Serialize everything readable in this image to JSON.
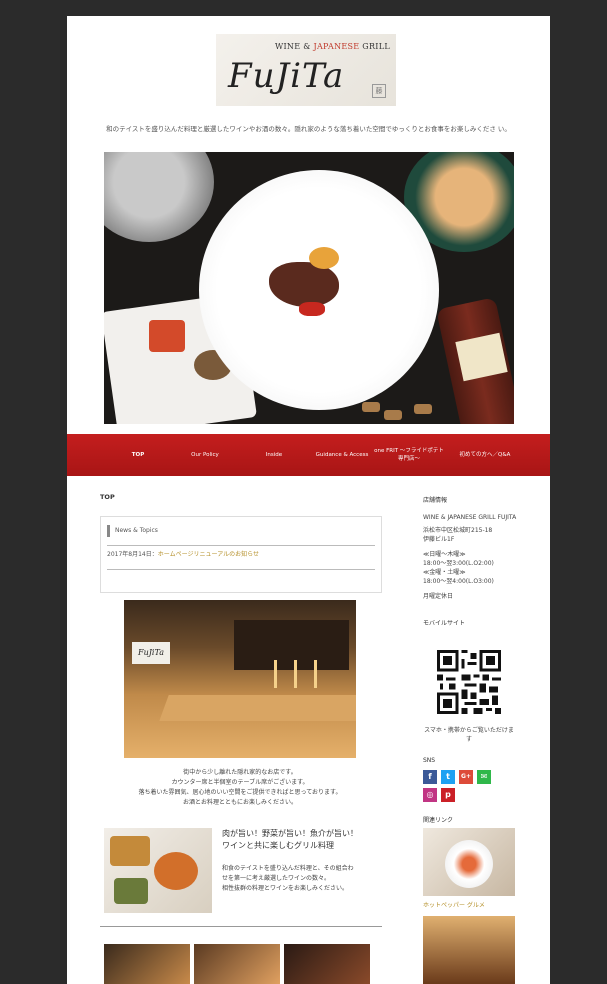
{
  "header": {
    "logo_tag_before": "WINE & ",
    "logo_tag_jp": "JAPANESE",
    "logo_tag_after": " GRILL",
    "logo_name": "FuJiTa",
    "logo_seal": "藤",
    "tagline": "和のテイストを盛り込んだ料理と厳選したワインやお酒の数々。隠れ家のような落ち着いた空間でゆっくりとお食事をお楽しみくださ い。"
  },
  "nav": {
    "items": [
      {
        "label": "TOP"
      },
      {
        "label": "Our Policy"
      },
      {
        "label": "Inside"
      },
      {
        "label": "Guidance & Access"
      },
      {
        "label": "one FRIT ～フライドポテト専門店～"
      },
      {
        "label": "初めての方へ／Q&A"
      }
    ]
  },
  "main": {
    "page_title": "TOP",
    "news": {
      "heading": "News & Topics",
      "date": "2017年8月14日",
      "sep": "：",
      "link": "ホームページリニューアルのお知らせ"
    },
    "intro_lines": [
      "街中から少し離れた隠れ家的なお店です。",
      "カウンター席と半個室のテーブル席がございます。",
      "落ち着いた雰囲気、居心地のいい空間をご提供できればと思っております。",
      "お酒とお料理とともにお楽しみください。"
    ],
    "feature": {
      "title_line1": "肉が旨い！野菜が旨い！魚介が旨い！",
      "title_line2": "ワインと共に楽しむグリル料理",
      "text_lines": [
        "和食のテイストを盛り込んだ料理と、その組合わ",
        "せを第一に考え厳選したワインの数々。",
        "相性抜群の料理とワインをお楽しみください。"
      ]
    },
    "interior_sign": "FuJiTa"
  },
  "sidebar": {
    "shop_info_heading": "店舗情報",
    "shop_name": "WINE & JAPANESE GRILL FUJITA",
    "address_line1": "浜松市中区松城町215-18",
    "address_line2": "伊藤ビル1F",
    "hours_line1": "≪日曜～木曜≫",
    "hours_line2": "18:00～翌3:00(L.O2:00)",
    "hours_line3": "≪金曜・土曜≫",
    "hours_line4": "18:00～翌4:00(L.O3:00)",
    "closed": "月曜定休日",
    "mobile_heading": "モバイルサイト",
    "mobile_caption": "スマホ・携帯からご覧いただけます",
    "sns_heading": "SNS",
    "sns_icons": [
      {
        "name": "facebook-icon",
        "glyph": "f",
        "color": "#3b5998"
      },
      {
        "name": "twitter-icon",
        "glyph": "t",
        "color": "#1da1f2"
      },
      {
        "name": "google-plus-icon",
        "glyph": "G+",
        "color": "#dd4b39"
      },
      {
        "name": "line-icon",
        "glyph": "✉",
        "color": "#2fb84a"
      },
      {
        "name": "instagram-icon",
        "glyph": "◎",
        "color": "#c13584"
      },
      {
        "name": "pinterest-icon",
        "glyph": "p",
        "color": "#cb2027"
      }
    ],
    "related_heading": "関連リンク",
    "related_caption": "ホットペッパー グルメ"
  },
  "colors": {
    "nav_red": "#b71a1a",
    "link_gold": "#b5902a",
    "page_bg": "#2b2b2b"
  }
}
